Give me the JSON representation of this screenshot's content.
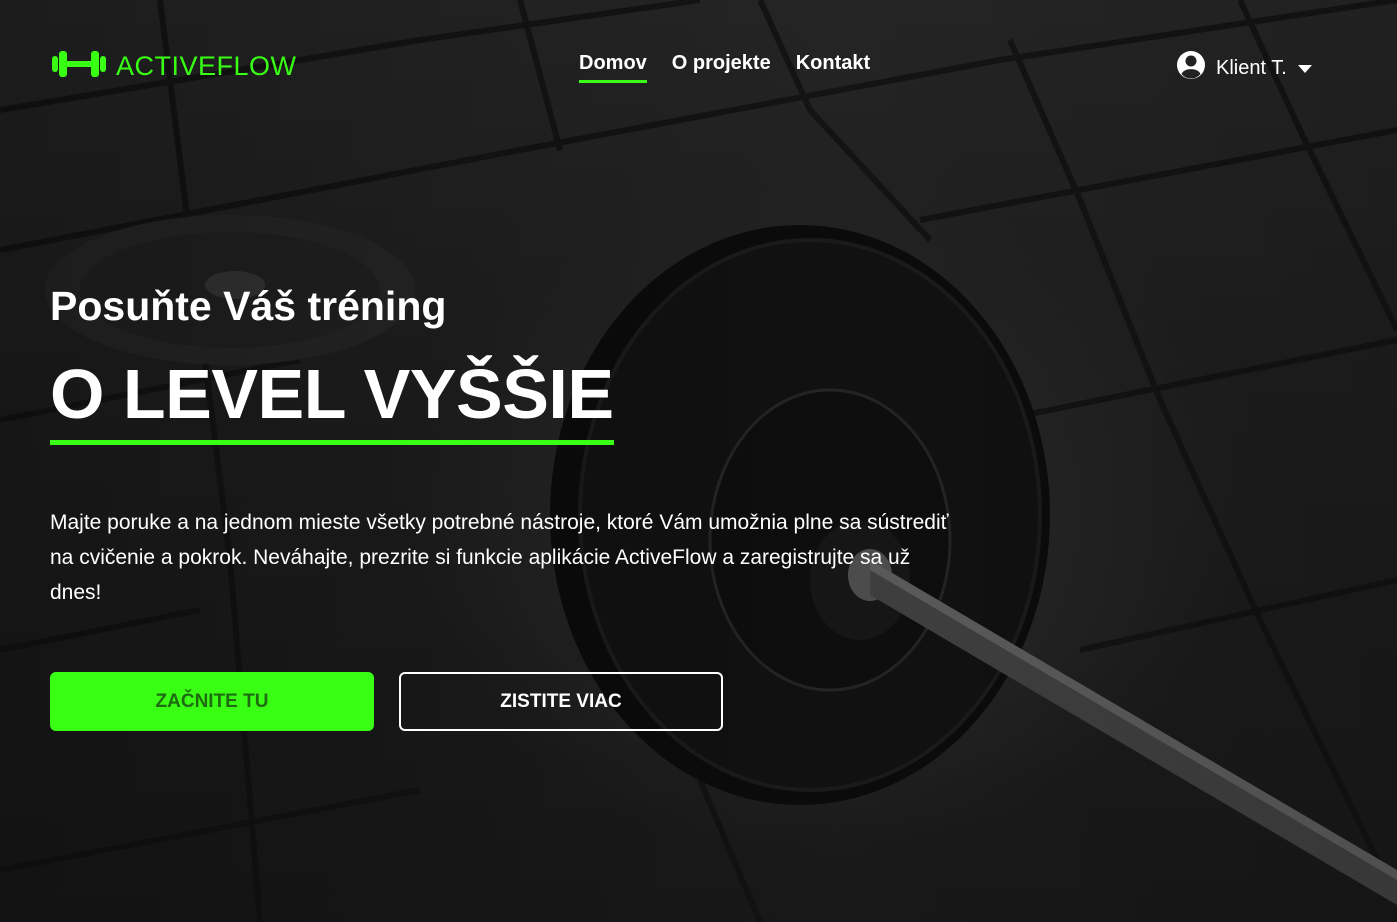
{
  "brand": {
    "name": "ACTIVEFLOW",
    "logo_icon": "dumbbell-icon",
    "accent_color": "#39ff14"
  },
  "nav": {
    "items": [
      {
        "label": "Domov",
        "active": true
      },
      {
        "label": "O projekte",
        "active": false
      },
      {
        "label": "Kontakt",
        "active": false
      }
    ]
  },
  "user_menu": {
    "name": "Klient T.",
    "avatar_icon": "user-circle-icon",
    "dropdown_icon": "caret-down-icon"
  },
  "hero": {
    "subtitle": "Posuňte Váš tréning",
    "title": "O LEVEL VYŠŠIE",
    "description": "Majte poruke a na jednom mieste všetky potrebné nástroje, ktoré Vám umožnia plne sa sústrediť na cvičenie a pokrok. Neváhajte, prezrite si funkcie aplikácie ActiveFlow a zaregistrujte sa už dnes!",
    "primary_button": "ZAČNITE TU",
    "secondary_button": "ZISTITE VIAC"
  }
}
